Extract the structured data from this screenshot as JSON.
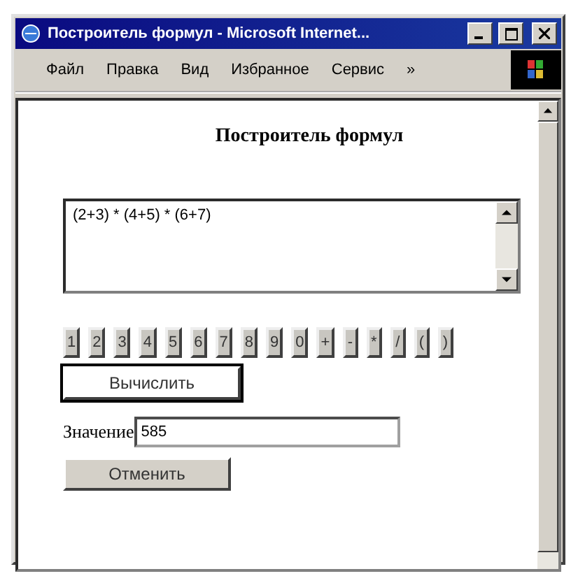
{
  "window": {
    "title": "Построитель формул - Microsoft Internet..."
  },
  "menu": [
    {
      "label": "Файл"
    },
    {
      "label": "Правка"
    },
    {
      "label": "Вид"
    },
    {
      "label": "Избранное"
    },
    {
      "label": "Сервис"
    },
    {
      "label": "»"
    }
  ],
  "page": {
    "heading": "Построитель формул",
    "formula": "(2+3) * (4+5) * (6+7)",
    "keys": [
      "1",
      "2",
      "3",
      "4",
      "5",
      "6",
      "7",
      "8",
      "9",
      "0",
      "+",
      "-",
      "*",
      "/",
      "(",
      ")"
    ],
    "calculate_button": {
      "label": "Вычислить",
      "focused": true
    },
    "result_label": "Значение",
    "result_value": "585",
    "reset_button": {
      "label": "Отменить"
    }
  }
}
